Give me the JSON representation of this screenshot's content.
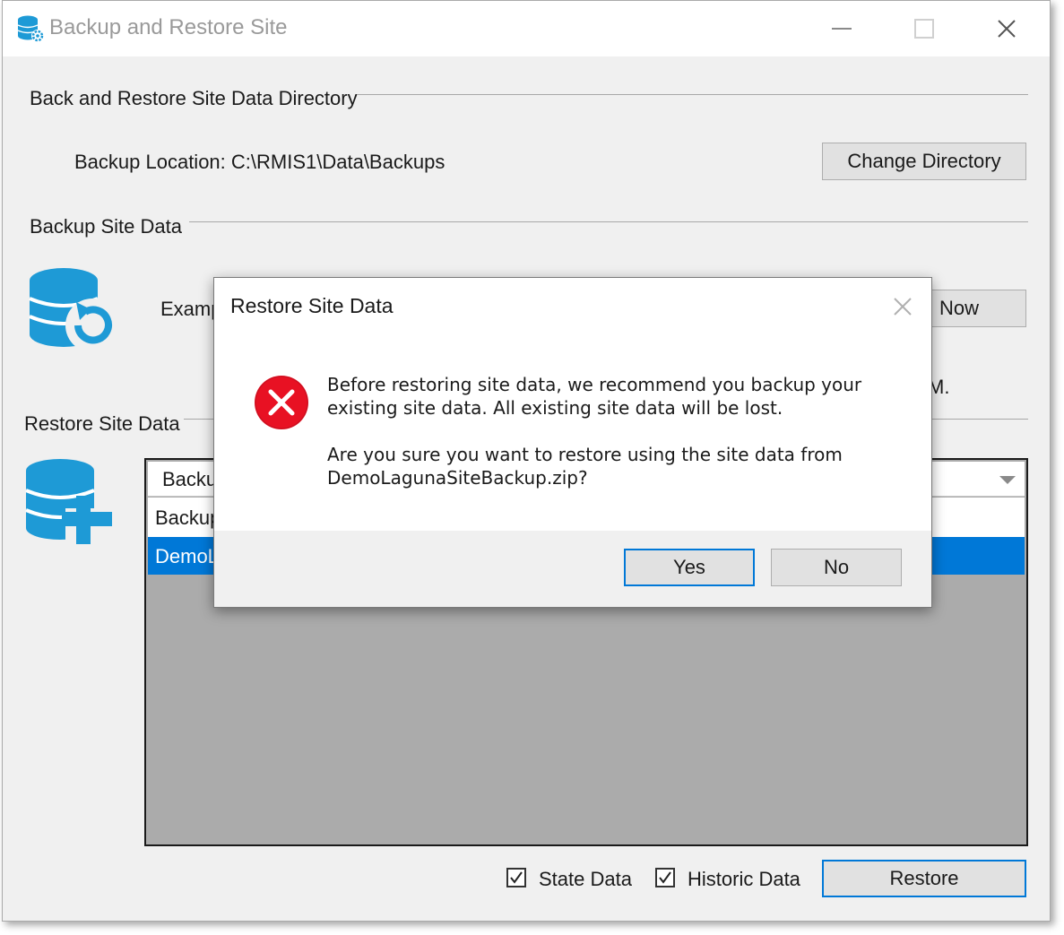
{
  "window": {
    "title": "Backup and Restore Site",
    "controls": [
      "minimize-icon",
      "maximize-icon",
      "close-icon"
    ]
  },
  "directory_section": {
    "heading": "Back and Restore Site Data Directory",
    "location_label": "Backup Location: C:\\RMIS1\\Data\\Backups",
    "change_button": "Change Directory"
  },
  "backup_section": {
    "heading": "Backup Site Data",
    "example_text": "Examp",
    "backup_button": "Now",
    "status_tail": "M."
  },
  "restore_section": {
    "heading": "Restore Site Data",
    "combo_value": "Backu",
    "column_header": "Backup",
    "selected_row": "DemoL",
    "state_data_label": "State Data",
    "state_data_checked": true,
    "historic_data_label": "Historic Data",
    "historic_data_checked": true,
    "restore_button": "Restore"
  },
  "dialog": {
    "title": "Restore Site Data",
    "message_line1": "Before restoring site data, we recommend you backup your",
    "message_line2": "existing site data. All existing site data will be lost.",
    "message_line3": "Are you sure you want to restore using the site data from",
    "message_line4": "DemoLagunaSiteBackup.zip?",
    "yes_button": "Yes",
    "no_button": "No",
    "icon": "error-icon"
  },
  "colors": {
    "accent": "#0078d7",
    "error": "#e81123",
    "db_icon": "#1e9ad6"
  }
}
